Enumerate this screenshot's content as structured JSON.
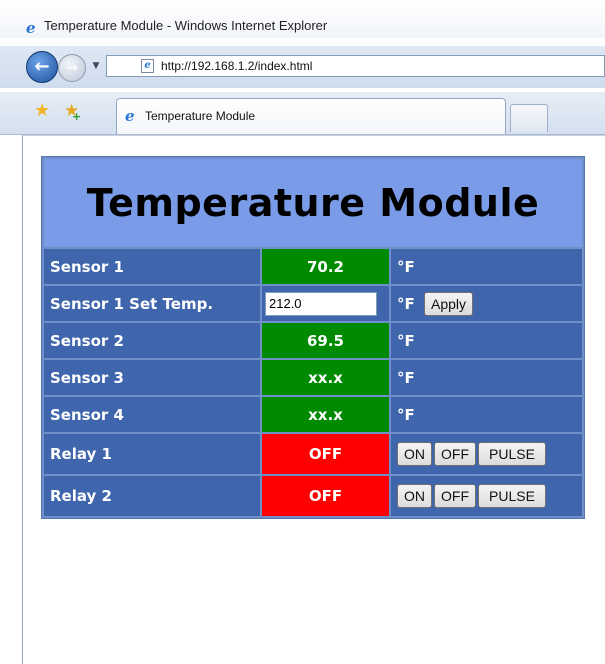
{
  "browser": {
    "window_title": "Temperature Module - Windows Internet Explorer",
    "url": "http://192.168.1.2/index.html",
    "tab_title": "Temperature Module"
  },
  "page": {
    "heading": "Temperature Module",
    "rows": [
      {
        "label": "Sensor 1",
        "value": "70.2",
        "unit": "°F"
      },
      {
        "label": "Sensor 1 Set Temp.",
        "input_value": "212.0",
        "unit": "°F",
        "button": "Apply"
      },
      {
        "label": "Sensor 2",
        "value": "69.5",
        "unit": "°F"
      },
      {
        "label": "Sensor 3",
        "value": "xx.x",
        "unit": "°F"
      },
      {
        "label": "Sensor 4",
        "value": "xx.x",
        "unit": "°F"
      },
      {
        "label": "Relay 1",
        "value": "OFF",
        "buttons": [
          "ON",
          "OFF",
          "PULSE"
        ]
      },
      {
        "label": "Relay 2",
        "value": "OFF",
        "buttons": [
          "ON",
          "OFF",
          "PULSE"
        ]
      }
    ]
  },
  "icons": {
    "ie": "ie-logo-icon",
    "favorites": "star-icon",
    "add_favorites": "add-favorite-icon",
    "back": "back-arrow-icon",
    "forward": "forward-arrow-icon"
  },
  "colors": {
    "header_bg": "#7a9ce8",
    "row_bg": "#3f65ac",
    "value_green": "#008a00",
    "value_red": "#ff0000"
  }
}
